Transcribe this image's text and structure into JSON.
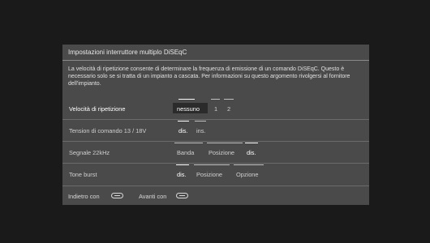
{
  "dialog": {
    "title": "Impostazioni interruttore multiplo DiSEqC",
    "description": "La velocità di ripetizione consente di determinare la frequenza di emissione di un comando DiSEqC. Questo è necessario solo se si tratta di un impianto a cascata. Per informazioni su questo argomento rivolgersi al fornitore dell'impianto."
  },
  "rows": [
    {
      "label": "Velocità di ripetizione",
      "options": [
        "nessuno",
        "1",
        "2"
      ],
      "selected": "nessuno"
    },
    {
      "label": "Tension di comando 13 / 18V",
      "options": [
        "dis.",
        "ins."
      ],
      "selected": "dis."
    },
    {
      "label": "Segnale 22kHz",
      "options": [
        "Banda",
        "Posizione",
        "dis."
      ],
      "selected": "dis."
    },
    {
      "label": "Tone burst",
      "options": [
        "dis.",
        "Posizione",
        "Opzione"
      ],
      "selected": "dis."
    }
  ],
  "footer": {
    "back_label": "Indietro con",
    "back_icon": "back-key-icon",
    "forward_label": "Avanti con",
    "forward_icon": "forward-key-icon"
  },
  "colors": {
    "background": "#1a1a1a",
    "dialog": "#4a4a4a",
    "focus_box": "#2b2b2b"
  }
}
